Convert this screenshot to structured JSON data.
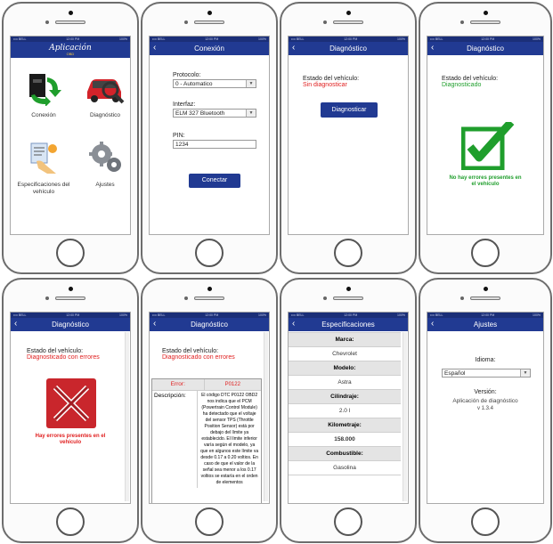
{
  "status": {
    "carrier": "•••• BELL",
    "time": "12:00 PM",
    "battery": "100%"
  },
  "home": {
    "logo_title": "Aplicación",
    "logo_sub": "OBD",
    "items": [
      {
        "label": "Conexión",
        "icon": "obd-connector-icon"
      },
      {
        "label": "Diagnóstico",
        "icon": "car-magnifier-icon"
      },
      {
        "label": "Especificaciones del vehículo",
        "icon": "spec-hand-icon"
      },
      {
        "label": "Ajustes",
        "icon": "gears-icon"
      }
    ]
  },
  "conexion": {
    "title": "Conexión",
    "protocol_label": "Protocolo:",
    "protocol_value": "0 - Automatico",
    "interface_label": "Interfaz:",
    "interface_value": "ELM 327 Bluetooth",
    "pin_label": "PIN:",
    "pin_value": "1234",
    "connect_button": "Conectar"
  },
  "diag1": {
    "title": "Diagnóstico",
    "state_label": "Estado del vehículo:",
    "state_value": "Sin diagnosticar",
    "button": "Diagnosticar"
  },
  "diag2": {
    "title": "Diagnóstico",
    "state_label": "Estado del vehículo:",
    "state_value": "Diagnosticado",
    "result": "No hay errores presentes en el vehículo"
  },
  "diag3": {
    "title": "Diagnóstico",
    "state_label": "Estado del vehículo:",
    "state_value": "Diagnosticado con errores",
    "result": "Hay errores presentes en el vehículo"
  },
  "diag4": {
    "title": "Diagnóstico",
    "state_label": "Estado del vehículo:",
    "state_value": "Diagnosticado con errores",
    "error_label": "Error:",
    "error_code": "P0122",
    "desc_label": "Descripción:",
    "desc_text": "El código DTC P0122 OBD2 nos indica que el PCM (Powertrain Control Module) ha detectado que el voltaje del sensor TPS (Throttle Position Sensor) está por debajo del límite ya establecido. El límite inferior varía según el modelo, ya que en algunos este límite va desde 0.17 a 0.20 voltios. En caso de que el valor de la señal sea menor a los 0.17 voltios se estaría en el orden de elementos"
  },
  "specs": {
    "title": "Especificaciones",
    "rows": [
      {
        "label": "Marca:",
        "value": "Chevrolet"
      },
      {
        "label": "Modelo:",
        "value": "Astra"
      },
      {
        "label": "Cilindraje:",
        "value": "2.0 l"
      },
      {
        "label": "Kilometraje:",
        "value": "158.000"
      },
      {
        "label": "Combustible:",
        "value": "Gasolina"
      }
    ]
  },
  "ajustes": {
    "title": "Ajustes",
    "language_label": "Idioma:",
    "language_value": "Español",
    "version_label": "Versión:",
    "version_app": "Aplicación de diagnóstico",
    "version_number": "v 1.3.4"
  },
  "colors": {
    "navbar": "#213a92",
    "error": "#e02020",
    "ok": "#1f9e2c"
  }
}
